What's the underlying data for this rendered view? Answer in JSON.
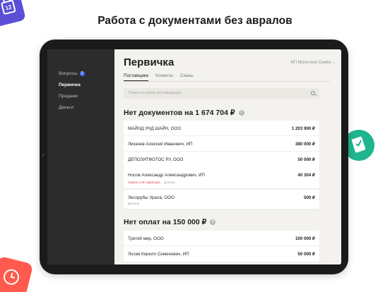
{
  "headline": "Работа с документами без авралов",
  "decor": {
    "calendar_number": "12",
    "colors": {
      "calendar": "#5b4fd6",
      "document": "#1fb58f",
      "clock": "#ff5a4d"
    }
  },
  "sidebar": {
    "items": [
      {
        "label": "Вопросы",
        "badge": "2"
      },
      {
        "label": "Первичка",
        "active": true
      },
      {
        "label": "Продажи"
      },
      {
        "label": "Деньги"
      }
    ]
  },
  "main": {
    "title": "Первичка",
    "user": "ИП Молотков Семён",
    "tabs": [
      "Поставщики",
      "Клиенты",
      "Сканы"
    ],
    "search_placeholder": "Поиск по всем поставщикам"
  },
  "sections": [
    {
      "heading": "Нет документов на 1 674 704 ₽",
      "rows": [
        {
          "name": "МАЙНД УНД ШАЙН, ООО",
          "amount": "1 203 900 ₽"
        },
        {
          "name": "Лихачев Алексей Иванович, ИП",
          "amount": "380 000 ₽"
        },
        {
          "name": "ДЕПОЗИТФОТОС РУ, ООО",
          "amount": "50 000 ₽"
        },
        {
          "name": "Носов Александр Александрович, ИП",
          "amount": "40 304 ₽",
          "tags": [
            "Нужен счёт-фактура",
            "Допник"
          ]
        },
        {
          "name": "Лесорубы Урала, ООО",
          "amount": "500 ₽",
          "tags": [
            "Допник"
          ]
        }
      ]
    },
    {
      "heading": "Нет оплат на 150 000 ₽",
      "rows": [
        {
          "name": "Третий мир, ООО",
          "amount": "100 000 ₽"
        },
        {
          "name": "Лосев Кирилл Семенович, ИП",
          "amount": "50 000 ₽"
        }
      ]
    }
  ]
}
